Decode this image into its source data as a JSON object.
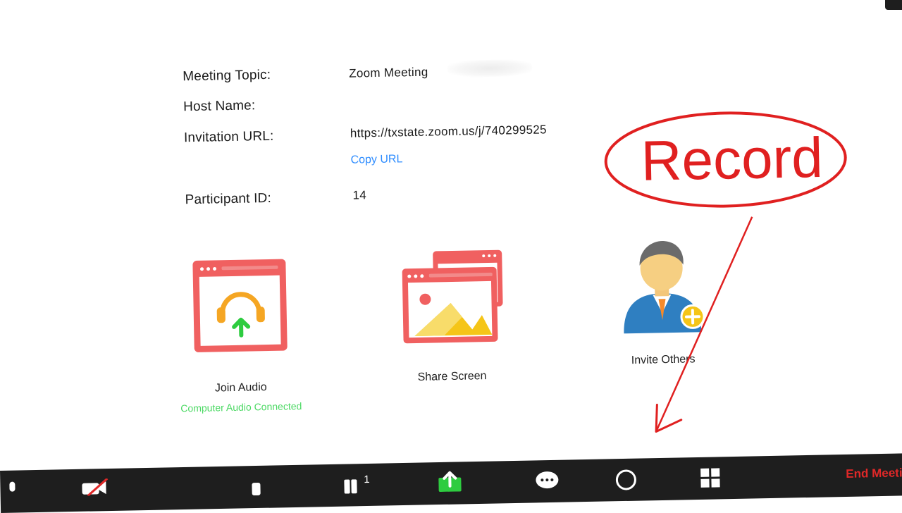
{
  "meeting_info": {
    "topic_label": "Meeting Topic:",
    "topic_value": "Zoom Meeting",
    "host_label": "Host Name:",
    "url_label": "Invitation URL:",
    "url_value": "https://txstate.zoom.us/j/740299525",
    "copy_url": "Copy URL",
    "participant_label": "Participant ID:",
    "participant_value": "14"
  },
  "actions": {
    "join_audio": "Join Audio",
    "audio_status": "Computer Audio Connected",
    "share_screen": "Share Screen",
    "invite_others": "Invite Others"
  },
  "annotation": {
    "text": "Record",
    "color": "#e02020"
  },
  "toolbar": {
    "participants_count": "1",
    "end_meeting": "End Meeting",
    "icons": [
      "mute-icon",
      "video-icon",
      "security-icon",
      "participants-icon",
      "share-screen-icon",
      "chat-icon",
      "record-icon",
      "breakout-rooms-icon"
    ]
  },
  "colors": {
    "accent_red": "#f06060",
    "link_blue": "#2d8cff",
    "connected_green": "#4cd964",
    "toolbar_bg": "#1e1e1e",
    "share_green": "#2ecc40"
  }
}
